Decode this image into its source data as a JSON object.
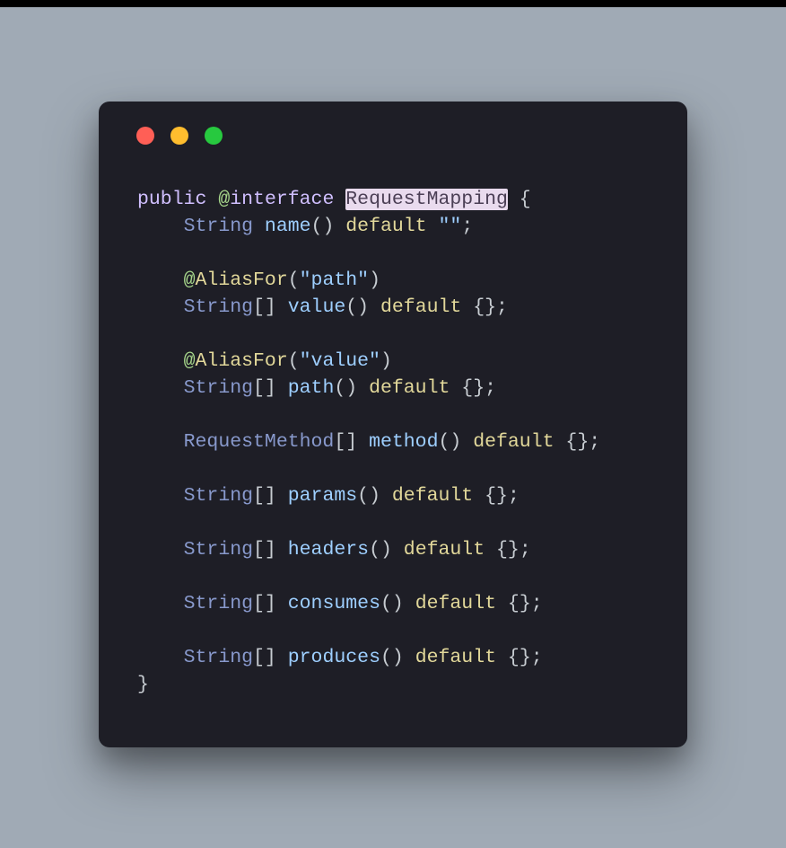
{
  "window": {
    "traffic_lights": [
      "red",
      "yellow",
      "green"
    ]
  },
  "code": {
    "line1": {
      "public": "public",
      "at": "@",
      "interface": "interface",
      "classname": "RequestMapping",
      "brace": " {"
    },
    "line2": {
      "type": "String",
      "method": " name",
      "parens": "() ",
      "default": "default",
      "value": " \"\"",
      "semi": ";"
    },
    "line3": {
      "at": "@",
      "annotation": "AliasFor",
      "open": "(",
      "str": "\"path\"",
      "close": ")"
    },
    "line4": {
      "type": "String",
      "brackets": "[] ",
      "method": "value",
      "parens": "() ",
      "default": "default",
      "value": " {}",
      "semi": ";"
    },
    "line5": {
      "at": "@",
      "annotation": "AliasFor",
      "open": "(",
      "str": "\"value\"",
      "close": ")"
    },
    "line6": {
      "type": "String",
      "brackets": "[] ",
      "method": "path",
      "parens": "() ",
      "default": "default",
      "value": " {}",
      "semi": ";"
    },
    "line7": {
      "type": "RequestMethod",
      "brackets": "[] ",
      "method": "method",
      "parens": "() ",
      "default": "default",
      "value": " {}",
      "semi": ";"
    },
    "line8": {
      "type": "String",
      "brackets": "[] ",
      "method": "params",
      "parens": "() ",
      "default": "default",
      "value": " {}",
      "semi": ";"
    },
    "line9": {
      "type": "String",
      "brackets": "[] ",
      "method": "headers",
      "parens": "() ",
      "default": "default",
      "value": " {}",
      "semi": ";"
    },
    "line10": {
      "type": "String",
      "brackets": "[] ",
      "method": "consumes",
      "parens": "() ",
      "default": "default",
      "value": " {}",
      "semi": ";"
    },
    "line11": {
      "type": "String",
      "brackets": "[] ",
      "method": "produces",
      "parens": "() ",
      "default": "default",
      "value": " {}",
      "semi": ";"
    },
    "line12": {
      "brace": "}"
    }
  }
}
